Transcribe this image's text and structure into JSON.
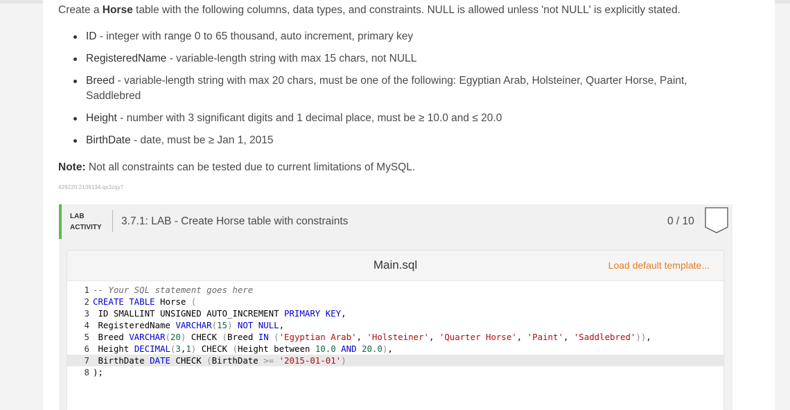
{
  "prompt": {
    "intro_before": "Create a ",
    "table_name": "Horse",
    "intro_after": " table with the following columns, data types, and constraints. NULL is allowed unless 'not NULL' is explicitly stated.",
    "columns": [
      {
        "name": "ID",
        "desc": " - integer with range 0 to 65 thousand, auto increment, primary key"
      },
      {
        "name": "RegisteredName",
        "desc": " - variable-length string with max 15 chars, not NULL"
      },
      {
        "name": "Breed",
        "desc": " - variable-length string with max 20 chars, must be one of the following: Egyptian Arab, Holsteiner, Quarter Horse, Paint, Saddlebred"
      },
      {
        "name": "Height",
        "desc": " - number with 3 significant digits and 1 decimal place, must be ≥ 10.0 and ≤ 20.0"
      },
      {
        "name": "BirthDate",
        "desc": " - date, must be ≥ Jan 1, 2015"
      }
    ],
    "note_label": "Note:",
    "note_text": " Not all constraints can be tested due to current limitations of MySQL.",
    "id_tag": "429220.2139134.qx3zqy7"
  },
  "lab": {
    "type_line1": "LAB",
    "type_line2": "ACTIVITY",
    "title": "3.7.1: LAB - Create Horse table with constraints",
    "score": "0 / 10",
    "accent_color": "#5cb85c"
  },
  "editor": {
    "file_name": "Main.sql",
    "load_template": "Load default template...",
    "lines": [
      {
        "n": "1",
        "tokens": [
          {
            "t": "-- Your SQL statement goes here",
            "c": "comment"
          }
        ]
      },
      {
        "n": "2",
        "tokens": [
          {
            "t": "CREATE TABLE",
            "c": "kw"
          },
          {
            "t": " Horse ",
            "c": "plain"
          },
          {
            "t": "(",
            "c": "op"
          }
        ]
      },
      {
        "n": "3",
        "tokens": [
          {
            "t": " ID SMALLINT UNSIGNED AUTO_INCREMENT ",
            "c": "plain"
          },
          {
            "t": "PRIMARY KEY",
            "c": "kw"
          },
          {
            "t": ",",
            "c": "plain"
          }
        ]
      },
      {
        "n": "4",
        "tokens": [
          {
            "t": " RegisteredName ",
            "c": "plain"
          },
          {
            "t": "VARCHAR",
            "c": "kw"
          },
          {
            "t": "(",
            "c": "op"
          },
          {
            "t": "15",
            "c": "num"
          },
          {
            "t": ") ",
            "c": "op"
          },
          {
            "t": "NOT NULL",
            "c": "kw"
          },
          {
            "t": ",",
            "c": "plain"
          }
        ]
      },
      {
        "n": "5",
        "tokens": [
          {
            "t": " Breed ",
            "c": "plain"
          },
          {
            "t": "VARCHAR",
            "c": "kw"
          },
          {
            "t": "(",
            "c": "op"
          },
          {
            "t": "20",
            "c": "num"
          },
          {
            "t": ") ",
            "c": "op"
          },
          {
            "t": "CHECK ",
            "c": "plain"
          },
          {
            "t": "(",
            "c": "op"
          },
          {
            "t": "Breed ",
            "c": "plain"
          },
          {
            "t": "IN",
            "c": "kw"
          },
          {
            "t": " (",
            "c": "op"
          },
          {
            "t": "'Egyptian Arab'",
            "c": "str"
          },
          {
            "t": ", ",
            "c": "plain"
          },
          {
            "t": "'Holsteiner'",
            "c": "str"
          },
          {
            "t": ", ",
            "c": "plain"
          },
          {
            "t": "'Quarter Horse'",
            "c": "str"
          },
          {
            "t": ", ",
            "c": "plain"
          },
          {
            "t": "'Paint'",
            "c": "str"
          },
          {
            "t": ", ",
            "c": "plain"
          },
          {
            "t": "'Saddlebred'",
            "c": "str"
          },
          {
            "t": "))",
            "c": "op"
          },
          {
            "t": ",",
            "c": "plain"
          }
        ]
      },
      {
        "n": "6",
        "tokens": [
          {
            "t": " Height ",
            "c": "plain"
          },
          {
            "t": "DECIMAL",
            "c": "kw"
          },
          {
            "t": "(",
            "c": "op"
          },
          {
            "t": "3",
            "c": "num"
          },
          {
            "t": ",",
            "c": "plain"
          },
          {
            "t": "1",
            "c": "num"
          },
          {
            "t": ") ",
            "c": "op"
          },
          {
            "t": "CHECK ",
            "c": "plain"
          },
          {
            "t": "(",
            "c": "op"
          },
          {
            "t": "Height between ",
            "c": "plain"
          },
          {
            "t": "10.0",
            "c": "num"
          },
          {
            "t": " ",
            "c": "plain"
          },
          {
            "t": "AND",
            "c": "kw"
          },
          {
            "t": " ",
            "c": "plain"
          },
          {
            "t": "20.0",
            "c": "num"
          },
          {
            "t": ")",
            "c": "op"
          },
          {
            "t": ",",
            "c": "plain"
          }
        ]
      },
      {
        "n": "7",
        "active": true,
        "tokens": [
          {
            "t": " BirthDate ",
            "c": "plain"
          },
          {
            "t": "DATE",
            "c": "kw"
          },
          {
            "t": " CHECK ",
            "c": "plain"
          },
          {
            "t": "(",
            "c": "op"
          },
          {
            "t": "BirthDate ",
            "c": "plain"
          },
          {
            "t": ">=",
            "c": "op"
          },
          {
            "t": " ",
            "c": "plain"
          },
          {
            "t": "'2015-01-01'",
            "c": "str"
          },
          {
            "t": ")",
            "c": "op"
          }
        ]
      },
      {
        "n": "8",
        "tokens": [
          {
            "t": ");",
            "c": "plain"
          }
        ]
      }
    ]
  }
}
